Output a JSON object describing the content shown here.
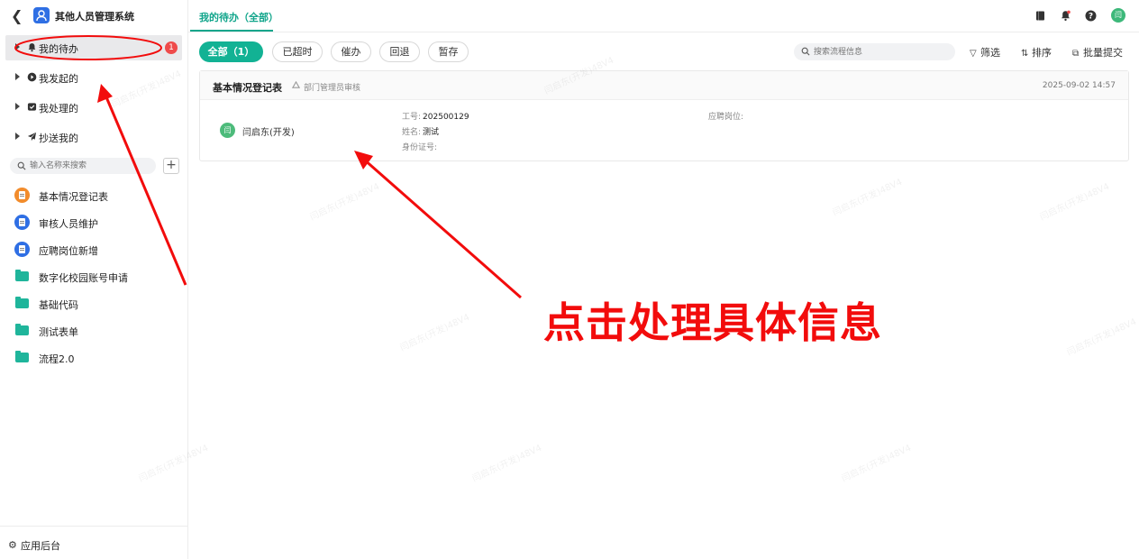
{
  "app": {
    "title": "其他人员管理系统"
  },
  "sidebar": {
    "nav": [
      {
        "label": "我的待办",
        "badge": "1",
        "active": true
      },
      {
        "label": "我发起的"
      },
      {
        "label": "我处理的"
      },
      {
        "label": "抄送我的"
      }
    ],
    "search_placeholder": "输入名称来搜索",
    "add_label": "+",
    "forms": [
      {
        "label": "基本情况登记表",
        "icon": "form-icon",
        "color": "#f28c2c"
      },
      {
        "label": "审核人员维护",
        "icon": "form-icon",
        "color": "#2f6fe4"
      },
      {
        "label": "应聘岗位新增",
        "icon": "form-icon",
        "color": "#2f6fe4"
      },
      {
        "label": "数字化校园账号申请",
        "icon": "folder-icon"
      },
      {
        "label": "基础代码",
        "icon": "folder-icon"
      },
      {
        "label": "测试表单",
        "icon": "folder-icon"
      },
      {
        "label": "流程2.0",
        "icon": "folder-icon"
      }
    ],
    "footer_label": "应用后台"
  },
  "topbar": {
    "tab_label": "我的待办（全部）",
    "avatar_text": "闫"
  },
  "filters": {
    "chips": [
      "全部（1）",
      "已超时",
      "催办",
      "回退",
      "暂存"
    ],
    "search_placeholder": "搜索流程信息",
    "filter_label": "筛选",
    "sort_label": "排序",
    "batch_label": "批量提交"
  },
  "task_card": {
    "title": "基本情况登记表",
    "node": "部门管理员审核",
    "time": "2025-09-02 14:57",
    "avatar_text": "闫",
    "user": "闫启东(开发)",
    "fields": {
      "job_no_label": "工号:",
      "job_no_value": "202500129",
      "name_label": "姓名:",
      "name_value": "测试",
      "id_label": "身份证号:",
      "position_label": "应聘岗位:"
    }
  },
  "annotation": {
    "text": "点击处理具体信息",
    "color": "#f20c0c"
  },
  "watermark_text": "闫启东(开发)48V4",
  "colors": {
    "accent": "#12b294",
    "badge": "#ef4b4b",
    "brand_logo": "#2f6fe4"
  }
}
